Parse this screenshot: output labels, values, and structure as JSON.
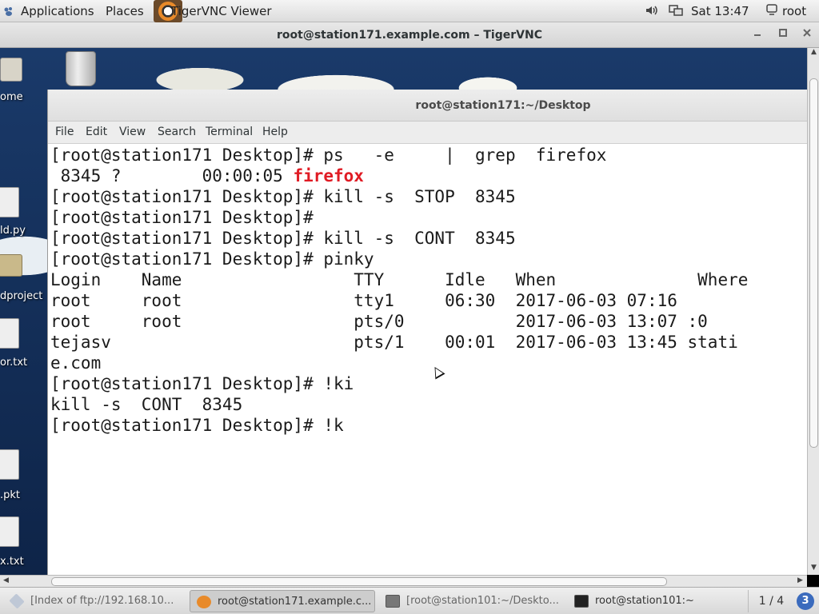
{
  "top_panel": {
    "applications_label": "Applications",
    "places_label": "Places",
    "active_app_label": "TigerVNC Viewer",
    "clock": "Sat 13:47",
    "user": "root"
  },
  "vnc_window": {
    "title": "root@station171.example.com – TigerVNC"
  },
  "desktop": {
    "icons": [
      {
        "label": "ome"
      },
      {
        "label": "ld.py"
      },
      {
        "label": "dproject"
      },
      {
        "label": "or.txt"
      },
      {
        "label": ".pkt"
      },
      {
        "label": "x.txt"
      }
    ]
  },
  "terminal": {
    "title": "root@station171:~/Desktop",
    "menu": [
      "File",
      "Edit",
      "View",
      "Search",
      "Terminal",
      "Help"
    ],
    "lines": {
      "l1": "[root@station171 Desktop]# ps   -e     |  grep  firefox",
      "l2_pre": " 8345 ?        00:00:05 ",
      "l2_hl": "firefox",
      "l3": "[root@station171 Desktop]# kill -s  STOP  8345",
      "l4": "[root@station171 Desktop]#",
      "l5": "[root@station171 Desktop]# kill -s  CONT  8345",
      "l6": "[root@station171 Desktop]# pinky",
      "l7": "Login    Name                 TTY      Idle   When              Where",
      "l8": "root     root                 tty1     06:30  2017-06-03 07:16",
      "l9": "root     root                 pts/0           2017-06-03 13:07 :0",
      "l10": "tejasv                        pts/1    00:01  2017-06-03 13:45 stati",
      "l11": "e.com",
      "l12": "[root@station171 Desktop]# !ki",
      "l13": "kill -s  CONT  8345",
      "l14": "[root@station171 Desktop]# !k"
    }
  },
  "taskbar": {
    "tasks": [
      {
        "label": "[Index of ftp://192.168.10...",
        "active": false
      },
      {
        "label": "root@station171.example.c...",
        "active": true
      },
      {
        "label": "[root@station101:~/Deskto...",
        "active": false
      },
      {
        "label": "root@station101:~",
        "active": false
      }
    ],
    "workspace": "1 / 4",
    "notifications": "3"
  },
  "colors": {
    "highlight_red": "#e01b24",
    "desktop_blue": "#16335f",
    "notification_blue": "#3b6bbd"
  }
}
